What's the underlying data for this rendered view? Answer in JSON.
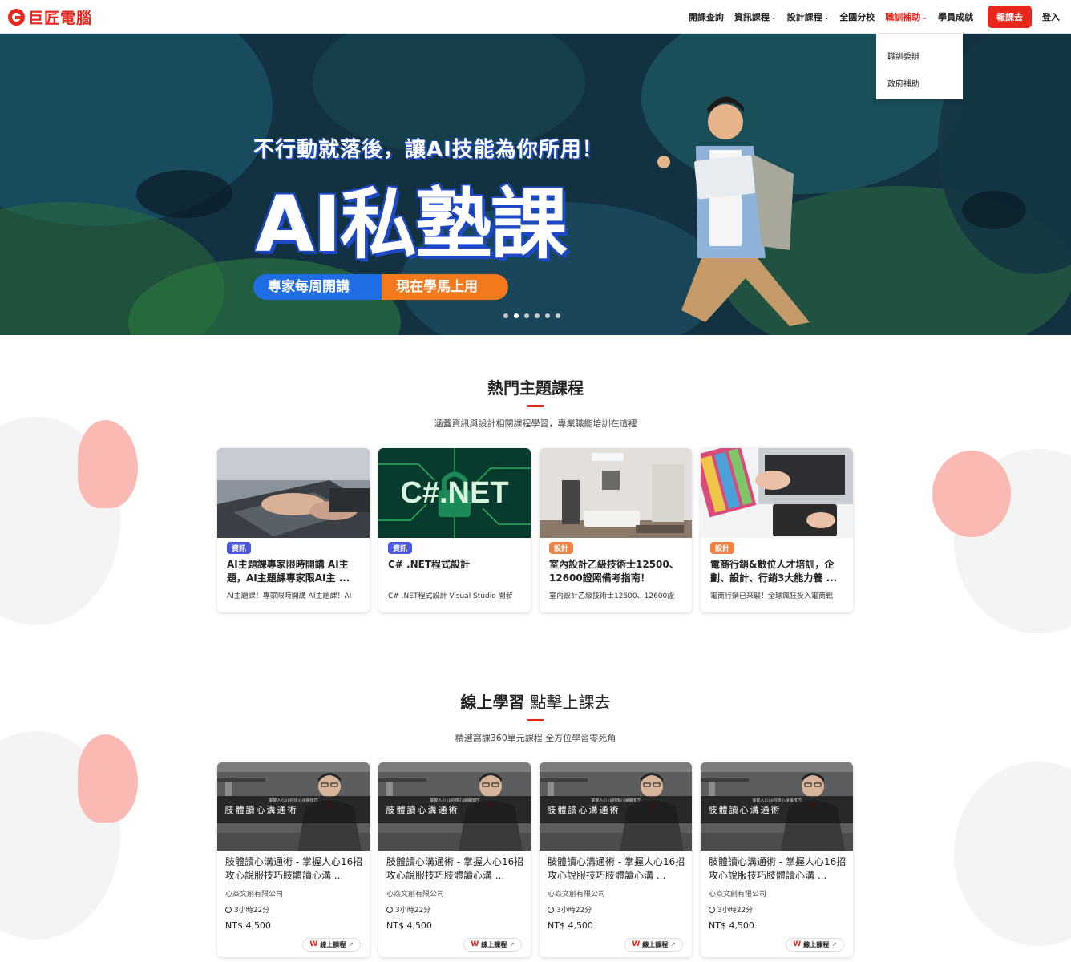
{
  "header": {
    "logo_text": "巨匠電腦",
    "nav": [
      {
        "label": "開課查詢",
        "dropdown": false
      },
      {
        "label": "資訊課程",
        "dropdown": true
      },
      {
        "label": "設計課程",
        "dropdown": true
      },
      {
        "label": "全國分校",
        "dropdown": false
      },
      {
        "label": "職訓補助",
        "dropdown": true,
        "active": true
      },
      {
        "label": "學員成就",
        "dropdown": false
      }
    ],
    "cta_label": "報課去",
    "login_label": "登入",
    "dropdown_items": [
      "職訓委辦",
      "政府補助"
    ]
  },
  "hero": {
    "subtitle": "不行動就落後，讓AI技能為你所用！",
    "title": "AI私塾課",
    "pill_left": "專家每周開講",
    "pill_right": "現在學馬上用",
    "slide_count": 6,
    "active_slide": 1
  },
  "hot": {
    "title": "熱門主題課程",
    "subtitle": "涵蓋資訊與設計相關課程學習，專業職能培訓在這裡",
    "cards": [
      {
        "tag": "資訊",
        "title": "AI主題課專家限時開講 AI主題，AI主題課專家限AI主 ...",
        "desc": "AI主題課！專家限時開講 AI主題課！AI"
      },
      {
        "tag": "資訊",
        "title": "C# .NET程式設計",
        "desc": "C# .NET程式設計 Visual Studio 開發",
        "image_text": "C#.NET"
      },
      {
        "tag": "設計",
        "title": "室內設計乙級技術士12500、12600證照備考指南！",
        "desc": "室內設計乙級技術士12500、12600證"
      },
      {
        "tag": "設計",
        "title": "電商行銷&數位人才培訓，企劃、設計、行銷3大能力養 ...",
        "desc": "電商行銷已來襲！全球瘋狂投入電商戰"
      }
    ]
  },
  "online": {
    "title_bold": "線上學習",
    "title_light": "點擊上課去",
    "subtitle": "精選窩課360單元課程 全方位學習零死角",
    "cards": [
      {
        "thumb_small": "掌握人心16招攻心說服技巧",
        "thumb_big": "肢體讀心溝通術",
        "title": "肢體讀心溝通術 - 掌握人心16招攻心說服技巧肢體讀心溝 ...",
        "company": "心焱文創有限公司",
        "duration": "3小時22分",
        "price": "NT$ 4,500",
        "button": "線上課程",
        "button_mark": "W"
      },
      {
        "thumb_small": "掌握人心16招攻心說服技巧",
        "thumb_big": "肢體讀心溝通術",
        "title": "肢體讀心溝通術 - 掌握人心16招攻心說服技巧肢體讀心溝 ...",
        "company": "心焱文創有限公司",
        "duration": "3小時22分",
        "price": "NT$ 4,500",
        "button": "線上課程",
        "button_mark": "W"
      },
      {
        "thumb_small": "掌握人心16招攻心說服技巧",
        "thumb_big": "肢體讀心溝通術",
        "title": "肢體讀心溝通術 - 掌握人心16招攻心說服技巧肢體讀心溝 ...",
        "company": "心焱文創有限公司",
        "duration": "3小時22分",
        "price": "NT$ 4,500",
        "button": "線上課程",
        "button_mark": "W"
      },
      {
        "thumb_small": "掌握人心16招攻心說服技巧",
        "thumb_big": "肢體讀心溝通術",
        "title": "肢體讀心溝通術 - 掌握人心16招攻心說服技巧肢體讀心溝 ...",
        "company": "心焱文創有限公司",
        "duration": "3小時22分",
        "price": "NT$ 4,500",
        "button": "線上課程",
        "button_mark": "W"
      }
    ]
  },
  "colors": {
    "brand": "#e8261c",
    "tag_info": "#4c57e0",
    "tag_design": "#f08344",
    "pill_blue": "#1f6ee6",
    "pill_orange": "#f2791c"
  }
}
